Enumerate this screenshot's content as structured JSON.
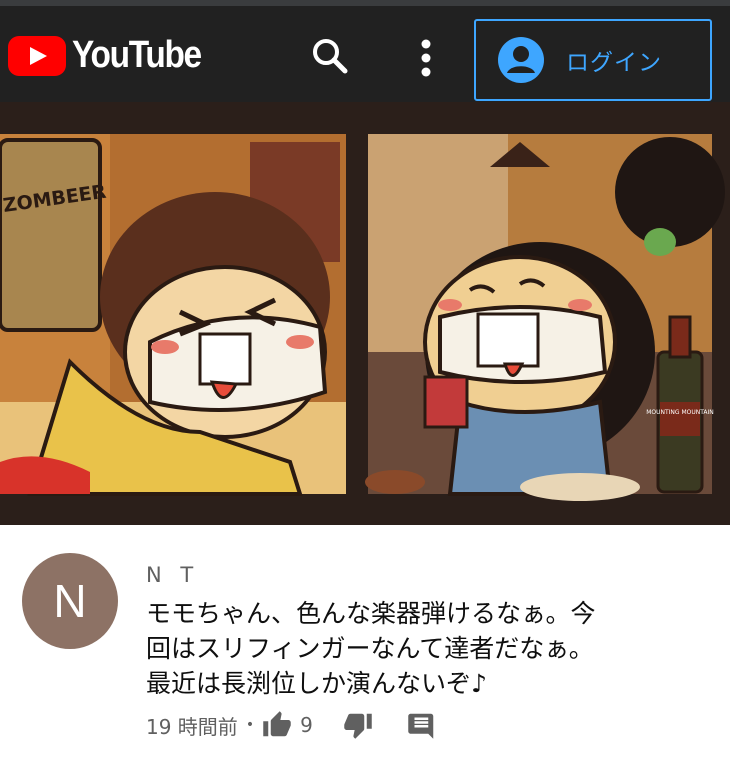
{
  "header": {
    "logo_text": "YouTube",
    "login_label": "ログイン",
    "icons": [
      "youtube-logo-icon",
      "search-icon",
      "more-vert-icon",
      "account-circle-icon"
    ],
    "colors": {
      "bar": "#212121",
      "brand_red": "#ff0000",
      "link_blue": "#3ea6ff"
    }
  },
  "video": {
    "thumbnail_signs": {
      "beer_can": "ZOMBEER",
      "wine_label": "MOUNTING MOUNTAIN"
    }
  },
  "comment": {
    "avatar_letter": "N",
    "author": "N T",
    "text": "モモちゃん、色んな楽器弾けるなぁ。今\n回はスリフィンガーなんて達者だなぁ。\n最近は長渕位しか演んないぞ♪",
    "timestamp": "19 時間前",
    "separator": "•",
    "like_count": "9",
    "icons": [
      "thumb-up-icon",
      "thumb-down-icon",
      "reply-icon"
    ]
  }
}
